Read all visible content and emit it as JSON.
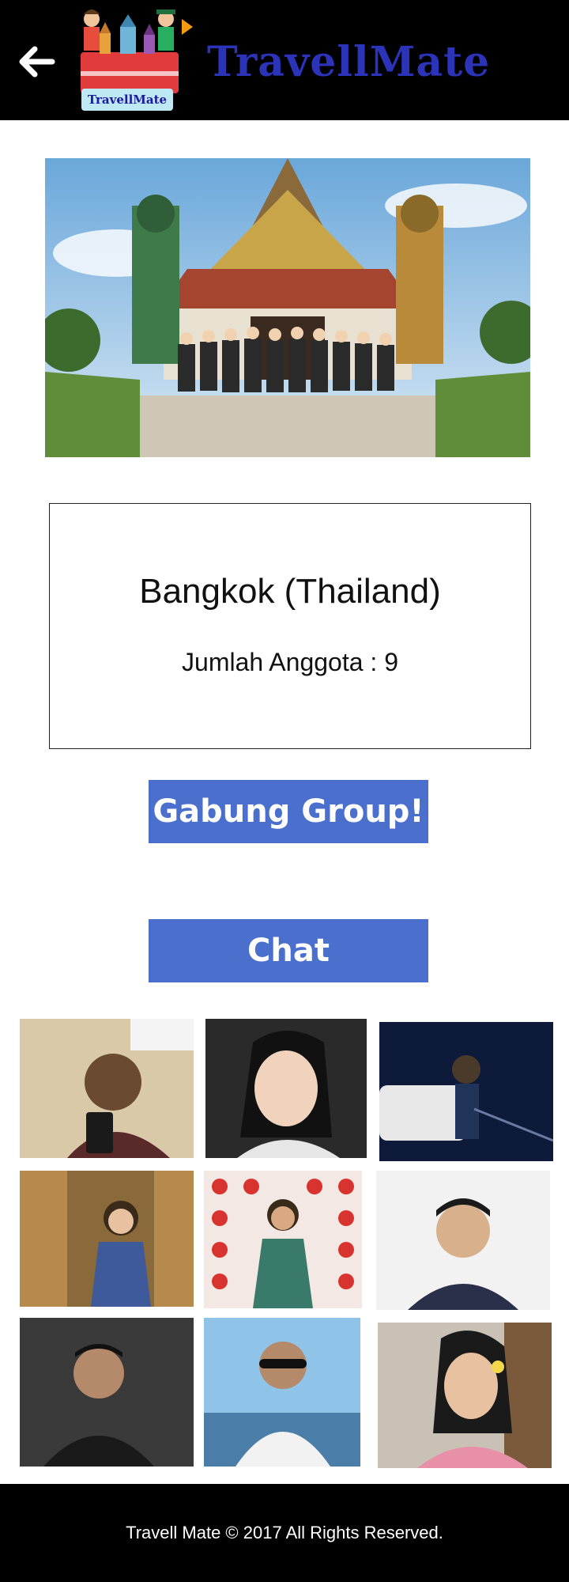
{
  "header": {
    "back_icon": "arrow-left-icon",
    "logo_badge_text": "TravellMate",
    "brand_name": "TravellMate"
  },
  "group": {
    "city": "Bangkok (Thailand)",
    "members_label": "Jumlah Anggota : 9"
  },
  "actions": {
    "join_label": "Gabung Group!",
    "chat_label": "Chat"
  },
  "members": [
    {
      "name": "member-1"
    },
    {
      "name": "member-2"
    },
    {
      "name": "member-3"
    },
    {
      "name": "member-4"
    },
    {
      "name": "member-5"
    },
    {
      "name": "member-6"
    },
    {
      "name": "member-7"
    },
    {
      "name": "member-8"
    },
    {
      "name": "member-9"
    }
  ],
  "footer": {
    "copyright": "Travell Mate © 2017 All Rights Reserved."
  },
  "colors": {
    "header_bg": "#000000",
    "brand": "#2b33b8",
    "button_bg": "#4a6fcd",
    "button_text": "#ffffff"
  }
}
